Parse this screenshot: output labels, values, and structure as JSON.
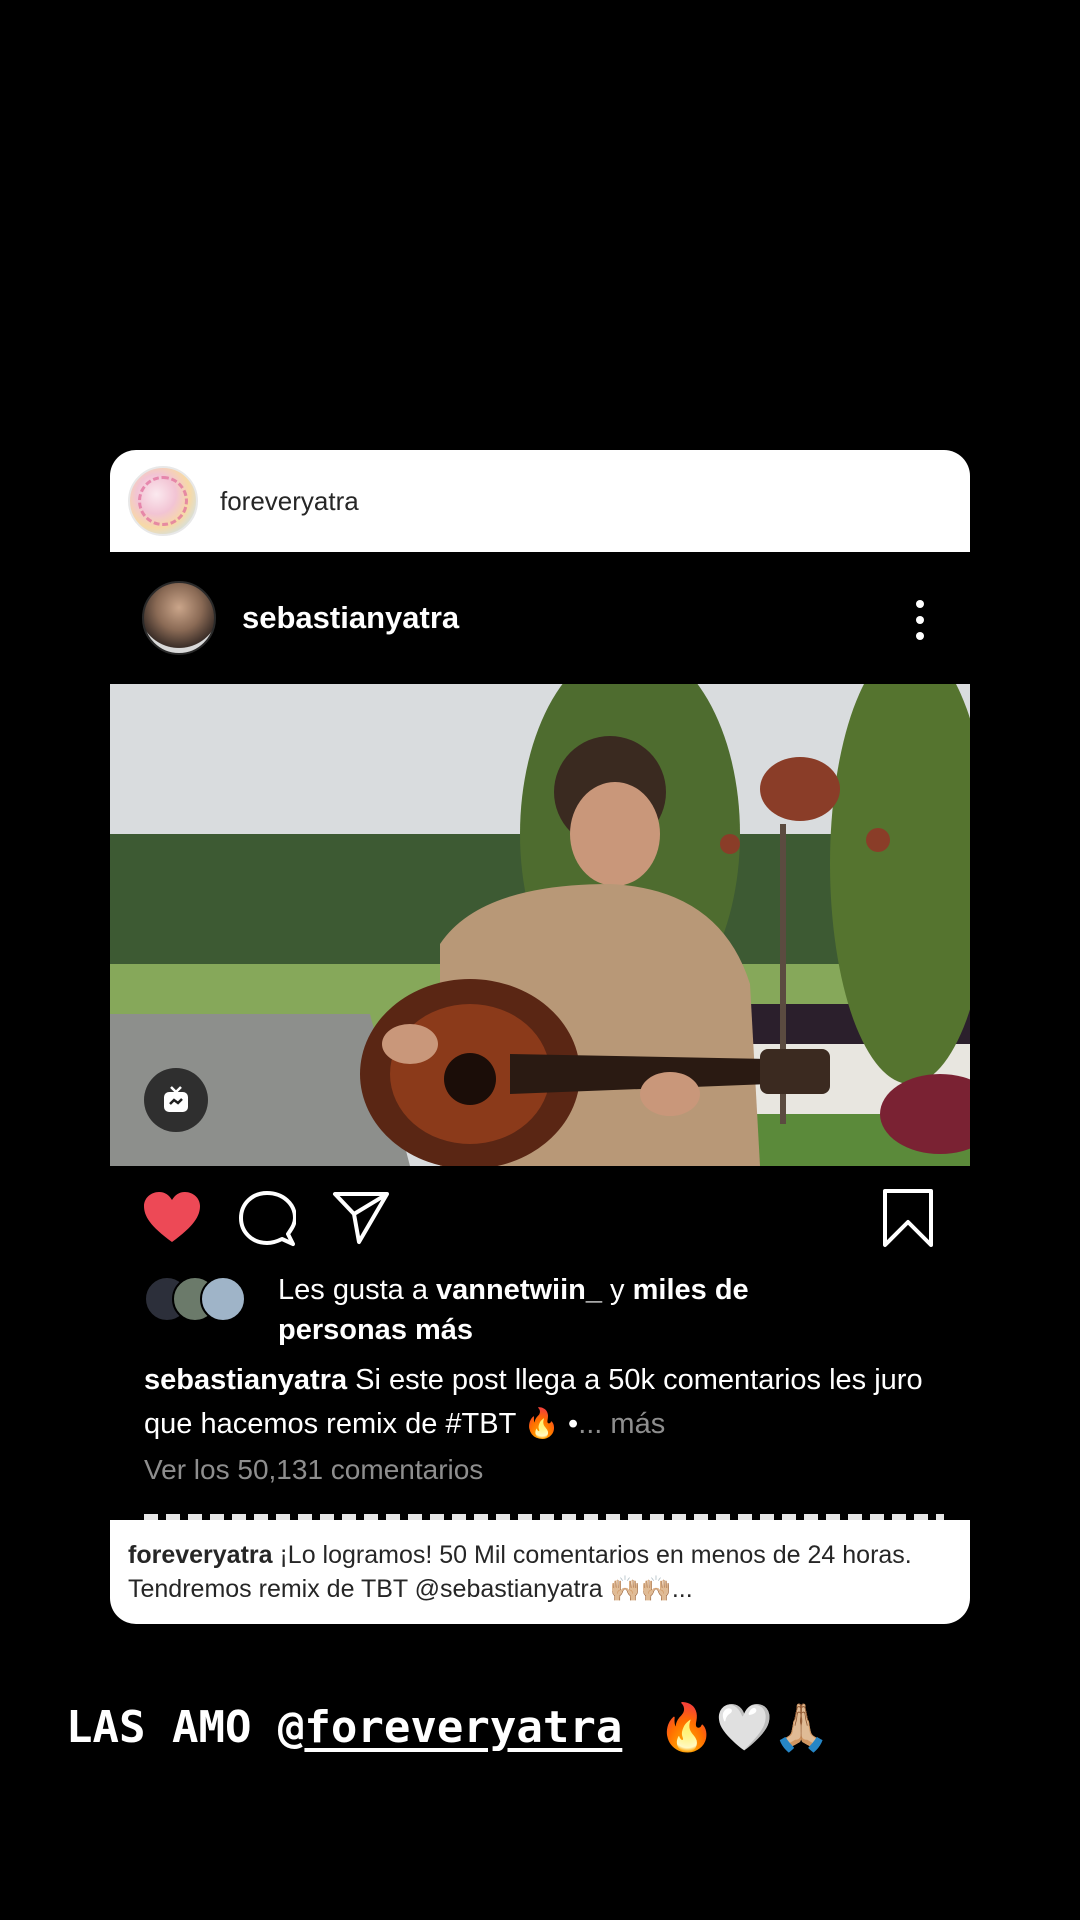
{
  "card": {
    "sharer_name": "foreveryatra",
    "post": {
      "author": "sebastianyatra",
      "likes_prefix": "Les gusta a ",
      "likes_user": "vannetwiin_",
      "likes_mid": " y ",
      "likes_rest": "miles de personas más",
      "caption_user": "sebastianyatra",
      "caption_text": " Si este post llega a 50k comentarios les juro que hacemos remix de #TBT 🔥 •",
      "caption_more": "... más",
      "view_comments": "Ver los 50,131 comentarios"
    },
    "footer": {
      "user": "foreveryatra",
      "text": " ¡Lo logramos! 50 Mil comentarios en menos de 24 horas. Tendremos remix de TBT @sebastianyatra 🙌🏼🙌🏼..."
    }
  },
  "story": {
    "prefix": "LAS AMO @",
    "mention": "foreveryatra",
    "emojis": "🔥🤍🙏🏼"
  },
  "colors": {
    "like": "#ed4956",
    "background": "#000000",
    "muted": "#8e8e8e"
  },
  "icons": [
    "heart-icon",
    "comment-icon",
    "share-icon",
    "bookmark-icon",
    "more-icon",
    "igtv-icon"
  ]
}
